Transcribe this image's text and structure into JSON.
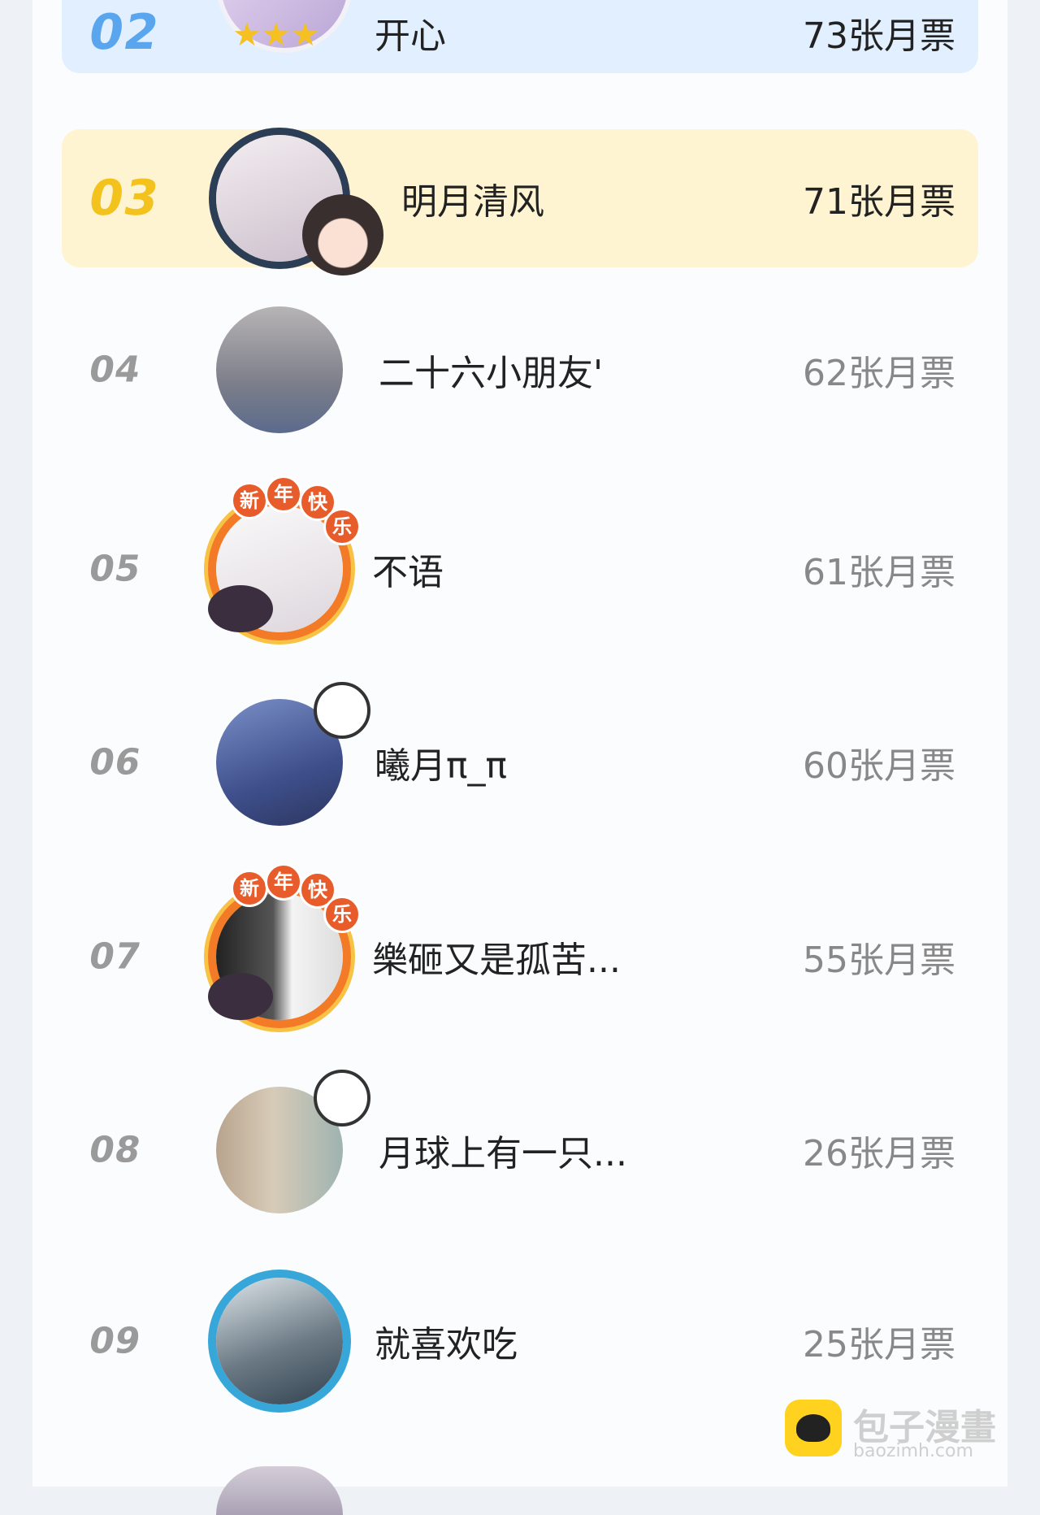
{
  "ranking": [
    {
      "rank": "02",
      "name": "开心",
      "votes": "73张月票"
    },
    {
      "rank": "03",
      "name": "明月清风",
      "votes": "71张月票"
    },
    {
      "rank": "04",
      "name": "二十六小朋友'",
      "votes": "62张月票"
    },
    {
      "rank": "05",
      "name": "不语",
      "votes": "61张月票"
    },
    {
      "rank": "06",
      "name": "曦月π_π",
      "votes": "60张月票"
    },
    {
      "rank": "07",
      "name": "樂砸又是孤苦...",
      "votes": "55张月票"
    },
    {
      "rank": "08",
      "name": "月球上有一只...",
      "votes": "26张月票"
    },
    {
      "rank": "09",
      "name": "就喜欢吃",
      "votes": "25张月票"
    }
  ],
  "badge_text": [
    "新",
    "年",
    "快",
    "乐"
  ],
  "watermark": {
    "text": "包子漫畫",
    "url": "baozimh.com"
  },
  "colors": {
    "blue_highlight": "#e1efff",
    "gold_highlight": "#fff4d2",
    "rank2": "#5aa6ee",
    "rank3": "#f4c21d"
  }
}
